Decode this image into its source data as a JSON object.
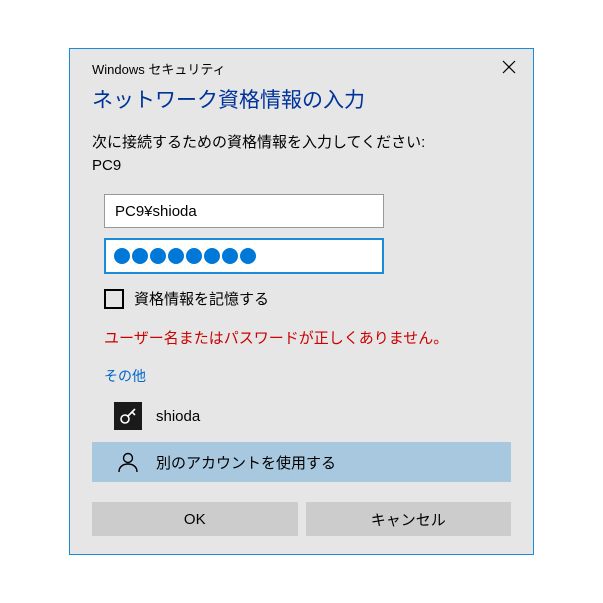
{
  "titlebar": {
    "title": "Windows セキュリティ"
  },
  "heading": "ネットワーク資格情報の入力",
  "instruction": "次に接続するための資格情報を入力してください:",
  "target": "PC9",
  "username": {
    "value": "PC9¥shioda"
  },
  "password": {
    "dot_count": 8
  },
  "checkbox": {
    "label": "資格情報を記憶する",
    "checked": false
  },
  "error": "ユーザー名またはパスワードが正しくありません。",
  "more_label": "その他",
  "credentials": [
    {
      "icon": "key",
      "label": "shioda",
      "selected": false
    },
    {
      "icon": "user",
      "label": "別のアカウントを使用する",
      "selected": true
    }
  ],
  "buttons": {
    "ok": "OK",
    "cancel": "キャンセル"
  }
}
